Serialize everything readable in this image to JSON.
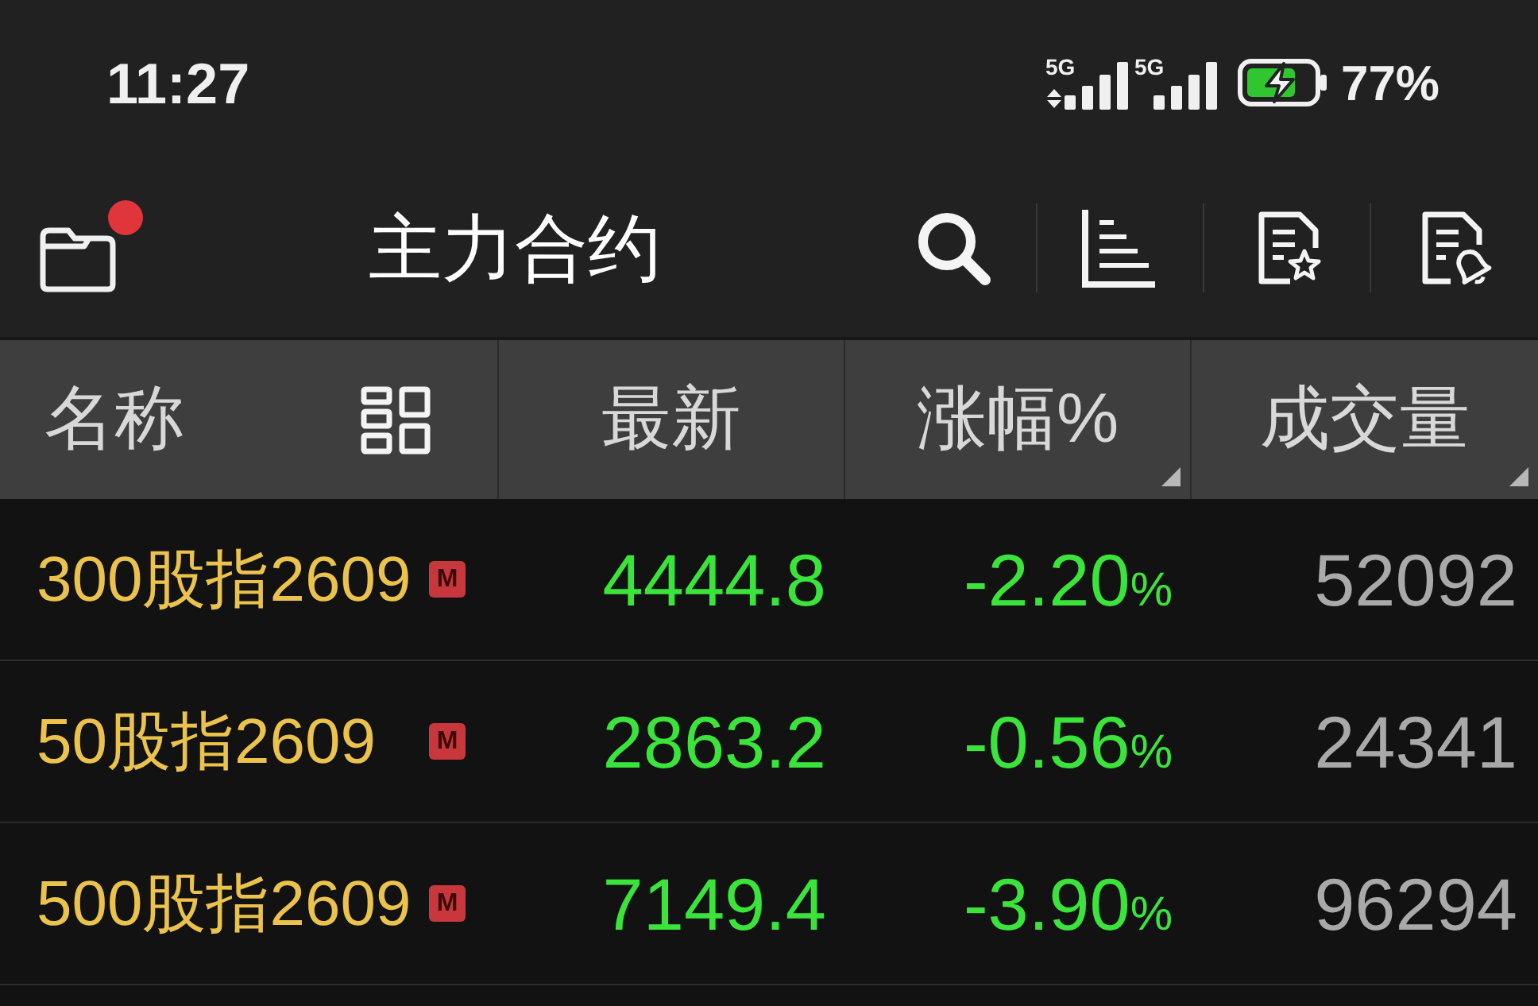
{
  "status_bar": {
    "time": "11:27",
    "signals": [
      {
        "label": "5G",
        "data_activity": true
      },
      {
        "label": "5G",
        "data_activity": false
      }
    ],
    "battery": {
      "charging": true,
      "percent": "77%"
    }
  },
  "toolbar": {
    "notification_dot": true,
    "title": "主力合约"
  },
  "table": {
    "columns": [
      {
        "label": "名称",
        "kind": "name",
        "sortable": false
      },
      {
        "label": "最新",
        "kind": "value",
        "sortable": false
      },
      {
        "label": "涨幅%",
        "kind": "value",
        "sortable": true
      },
      {
        "label": "成交量",
        "kind": "value",
        "sortable": true
      }
    ],
    "rows": [
      {
        "name": "300股指2609",
        "tag": "M",
        "price": "4444.8",
        "change": "-2.20",
        "change_unit": "%",
        "volume": "52092",
        "falling": true
      },
      {
        "name": "50股指2609",
        "tag": "M",
        "price": "2863.2",
        "change": "-0.56",
        "change_unit": "%",
        "volume": "24341",
        "falling": true
      },
      {
        "name": "500股指2609",
        "tag": "M",
        "price": "7149.4",
        "change": "-3.90",
        "change_unit": "%",
        "volume": "96294",
        "falling": true
      }
    ]
  }
}
